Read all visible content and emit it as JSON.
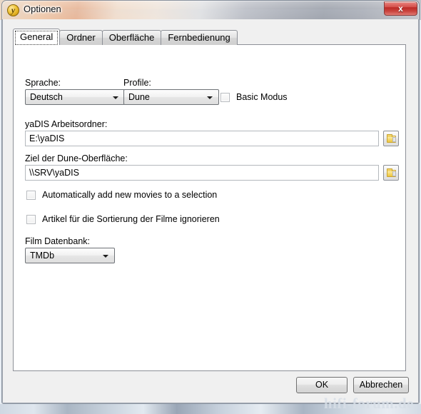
{
  "window": {
    "title": "Optionen",
    "icon": "yadis-coin-icon",
    "close_label": "x",
    "accent_close": "#bc2a26",
    "frame_bg": "#f0f0f0"
  },
  "tabs": [
    {
      "label": "General",
      "active": true
    },
    {
      "label": "Ordner",
      "active": false
    },
    {
      "label": "Oberfläche",
      "active": false
    },
    {
      "label": "Fernbedienung",
      "active": false
    }
  ],
  "general": {
    "language": {
      "label": "Sprache:",
      "value": "Deutsch"
    },
    "profile": {
      "label": "Profile:",
      "value": "Dune"
    },
    "basic_mode": {
      "label": "Basic Modus",
      "checked": false
    },
    "work_folder": {
      "label": "yaDIS Arbeitsordner:",
      "value": "E:\\yaDIS",
      "browse_icon": "folder-icon"
    },
    "dune_target": {
      "label": "Ziel der Dune-Oberfläche:",
      "value": "\\\\SRV\\yaDIS",
      "browse_icon": "folder-icon"
    },
    "auto_add_movies": {
      "label": "Automatically add new movies to a selection",
      "checked": false
    },
    "ignore_articles": {
      "label": "Artikel für die Sortierung der Filme ignorieren",
      "checked": false
    },
    "movie_db": {
      "label": "Film Datenbank:",
      "value": "TMDb"
    }
  },
  "footer": {
    "ok_label": "OK",
    "cancel_label": "Abbrechen"
  },
  "watermark": "hifi-forum.de"
}
